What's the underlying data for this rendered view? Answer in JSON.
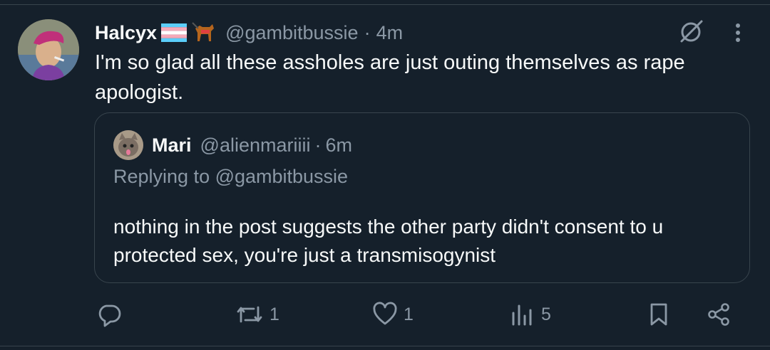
{
  "tweet": {
    "author_name": "Halcyx",
    "handle": "@gambitbussie",
    "separator": "·",
    "time": "4m",
    "text": "I'm so glad all these assholes are just outing themselves as rape apologist."
  },
  "quote": {
    "author_name": "Mari",
    "handle": "@alienmariiii",
    "separator": "·",
    "time": "6m",
    "replying_to": "Replying to @gambitbussie",
    "text": "nothing in the post suggests the other party didn't consent to u protected sex, you're just a transmisogynist"
  },
  "actions": {
    "reply_count": "",
    "retweet_count": "1",
    "like_count": "1",
    "views_count": "5"
  },
  "icons": [
    "trans-flag-icon",
    "service-dog-icon",
    "grok-icon",
    "more-icon",
    "reply-icon",
    "retweet-icon",
    "like-icon",
    "views-icon",
    "bookmark-icon",
    "share-icon"
  ],
  "colors": {
    "background": "#15202b",
    "text": "#f7f9f9",
    "secondary": "#8b98a5",
    "border": "#38444d"
  }
}
